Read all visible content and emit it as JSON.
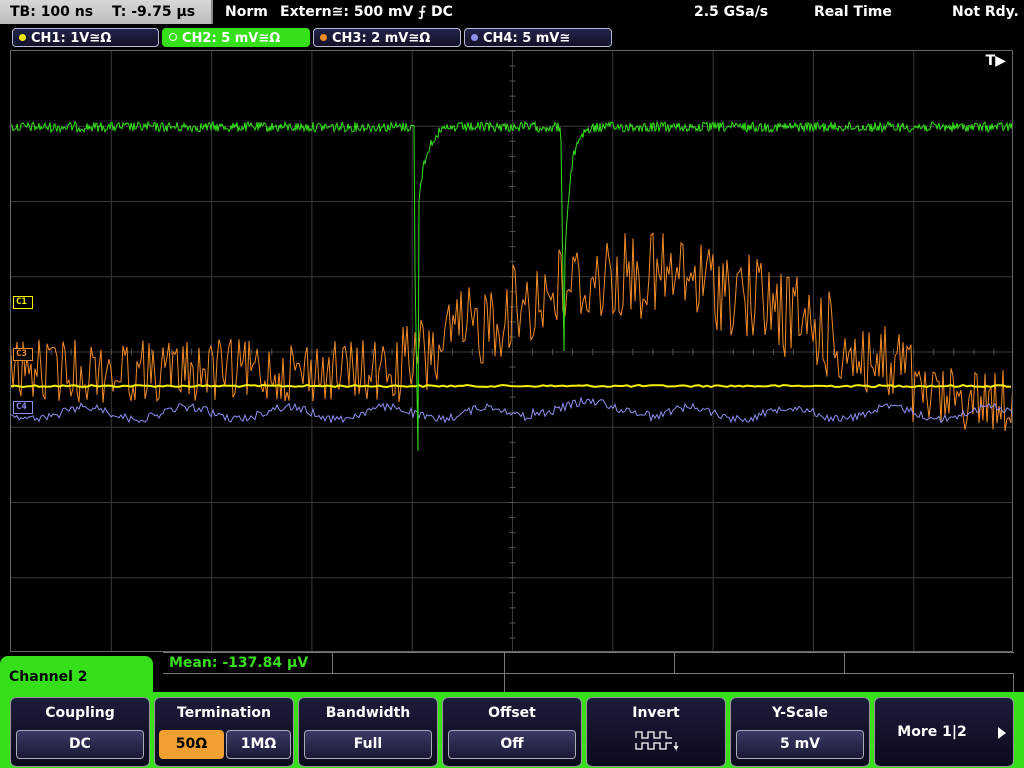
{
  "topbar": {
    "timebase": "TB: 100 ns",
    "trigger_time": "T: -9.75 µs",
    "mode": "Norm",
    "trigger": "Extern≅: 500 mV ⨍ DC",
    "sample_rate": "2.5 GSa/s",
    "acq_mode": "Real Time",
    "status": "Not Rdy."
  },
  "channels": [
    {
      "label": "CH1: 1V≅Ω",
      "color": "#f5f000"
    },
    {
      "label": "CH2: 5 mV≅Ω",
      "color": "#35e01a"
    },
    {
      "label": "CH3: 2 mV≅Ω",
      "color": "#f28c28"
    },
    {
      "label": "CH4: 5 mV≅",
      "color": "#8e8ef0"
    }
  ],
  "markers": {
    "c1": "C1",
    "c3": "C3",
    "c4": "C4",
    "trigger_flag": "T▶"
  },
  "measurement": {
    "mean": "Mean: -137.84 µV"
  },
  "menu": {
    "title": "Channel 2",
    "coupling": {
      "label": "Coupling",
      "value": "DC"
    },
    "termination": {
      "label": "Termination",
      "opt1": "50Ω",
      "opt2": "1MΩ",
      "selected": "50Ω"
    },
    "bandwidth": {
      "label": "Bandwidth",
      "value": "Full"
    },
    "offset": {
      "label": "Offset",
      "value": "Off"
    },
    "invert": {
      "label": "Invert",
      "icon": "invert-waveform-icon"
    },
    "yscale": {
      "label": "Y-Scale",
      "value": "5 mV"
    },
    "more": {
      "label": "More 1|2",
      "icon": "right-arrow-icon"
    }
  }
}
